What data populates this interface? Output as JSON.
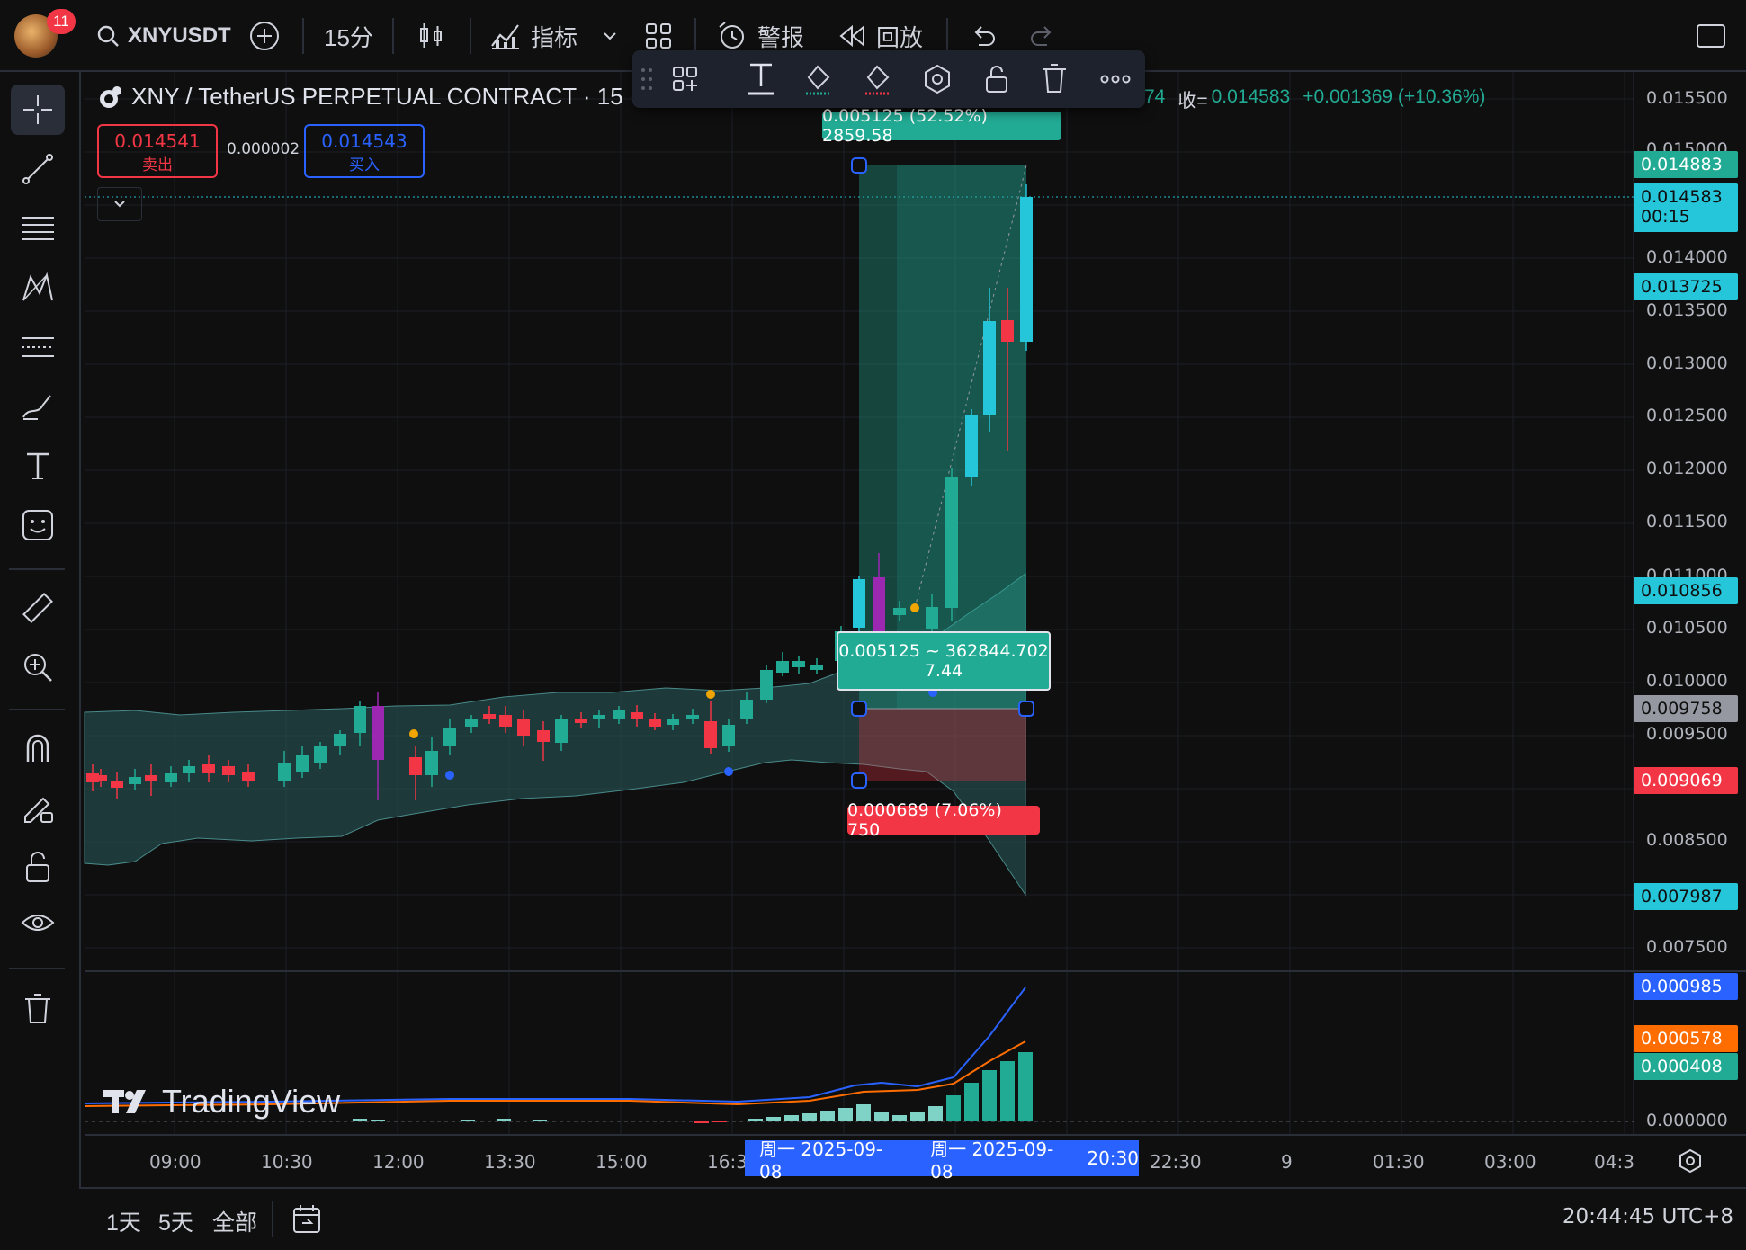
{
  "topbar": {
    "notification_count": "11",
    "symbol": "XNYUSDT",
    "interval": "15分",
    "indicators": "指标",
    "alerts": "警报",
    "replay": "回放"
  },
  "legend": {
    "title": "XNY / TetherUS PERPETUAL CONTRACT · 15 ·",
    "ohlc_tail": "74",
    "close_label": "收=",
    "close_value": "0.014583",
    "change": "+0.001369 (+10.36%)"
  },
  "trade": {
    "sell_price": "0.014541",
    "sell_label": "卖出",
    "spread": "0.000002",
    "buy_price": "0.014543",
    "buy_label": "买入"
  },
  "position_tool": {
    "target_label": "0.005125 (52.52%) 2859.58",
    "center_line1": "0.005125 ~ 362844.702",
    "center_line2": "7.44",
    "stop_label": "0.000689 (7.06%) 750"
  },
  "price_axis": {
    "labels": [
      "0.015500",
      "0.015000",
      "0.014000",
      "0.013500",
      "0.013000",
      "0.012500",
      "0.012000",
      "0.011500",
      "0.011000",
      "0.010500",
      "0.010000",
      "0.009500",
      "0.008500",
      "0.007500",
      "0.000000"
    ],
    "tags": {
      "target": "0.014883",
      "last_price": "0.014583",
      "countdown": "00:15",
      "bb_upper": "0.013725",
      "bb_mid": "0.010856",
      "entry": "0.009758",
      "stop": "0.009069",
      "bb_lower": "0.007987",
      "macd_line": "0.000985",
      "signal_line": "0.000578",
      "histogram": "0.000408"
    }
  },
  "time_axis": {
    "labels": [
      "09:00",
      "10:30",
      "12:00",
      "13:30",
      "15:00",
      "16:3",
      "22:30",
      "9",
      "01:30",
      "03:00",
      "04:3"
    ],
    "range_start": "周一 2025-09-08",
    "range_end": "周一 2025-09-08",
    "range_end_time": "20:30"
  },
  "bottombar": {
    "ranges": [
      "1天",
      "5天",
      "全部"
    ],
    "clock": "20:44:45 UTC+8"
  },
  "watermark": "TradingView",
  "colors": {
    "bg": "#0f0f0f",
    "up": "#22ab94",
    "up_bright": "#26c6da",
    "down": "#f23645",
    "purple": "#9c27b0",
    "band": "#2a5c5c",
    "accent_blue": "#2962ff",
    "orange": "#ff6d00"
  }
}
